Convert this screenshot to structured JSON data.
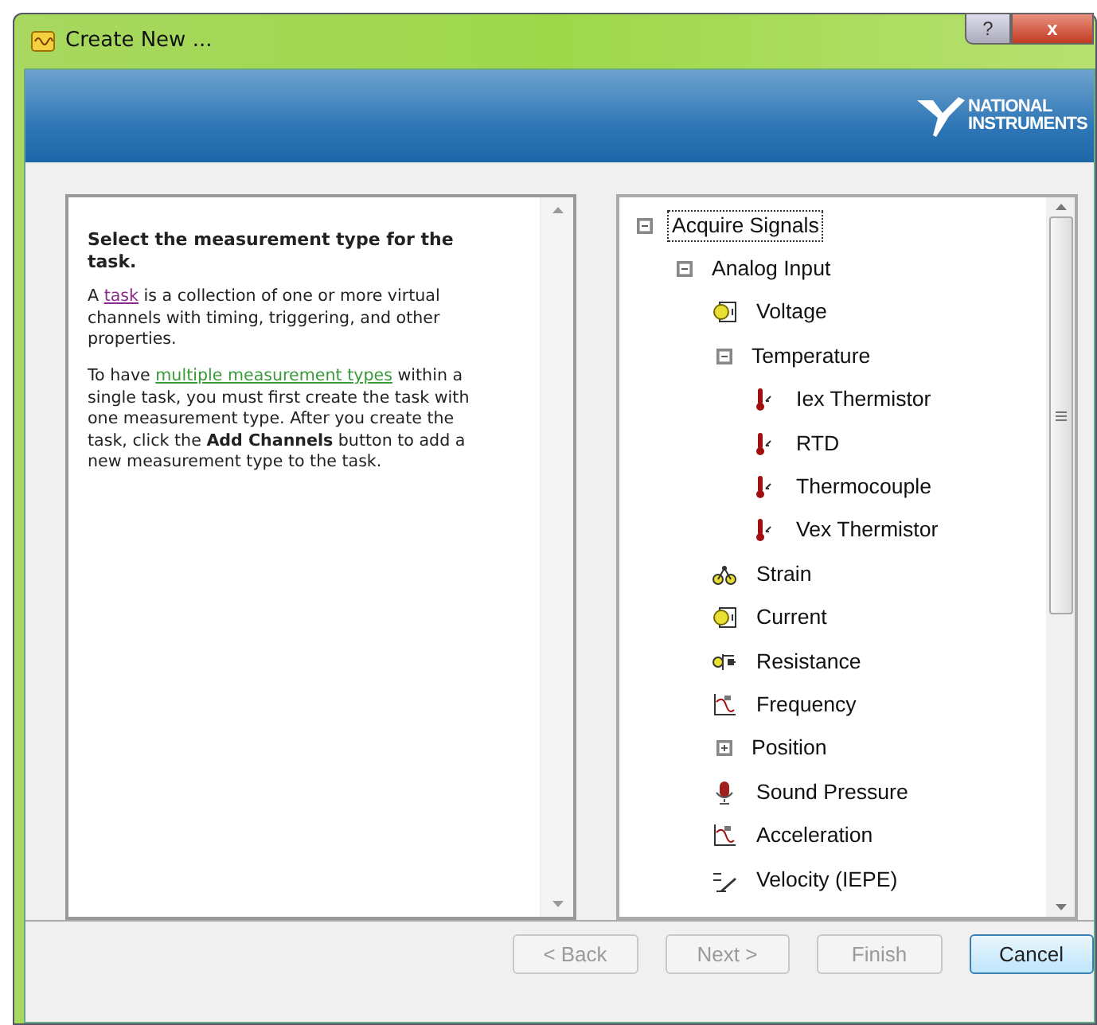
{
  "window": {
    "title": "Create New ..."
  },
  "title_buttons": [
    "?",
    "x"
  ],
  "banner": {
    "logo_top": "NATIONAL",
    "logo_bottom": "INSTRUMENTS"
  },
  "help": {
    "heading": "Select the measurement type for the task.",
    "paragraphs": [
      [
        {
          "kind": "text",
          "text": "A "
        },
        {
          "kind": "link",
          "text": "task",
          "visited": true
        },
        {
          "kind": "text",
          "text": " is a collection of one or more virtual channels with timing, triggering, and other properties."
        }
      ],
      [
        {
          "kind": "text",
          "text": "To have "
        },
        {
          "kind": "link",
          "text": "multiple measurement types",
          "visited": false
        },
        {
          "kind": "text",
          "text": " within a single task, you must first create the task with one measurement type. After you create the task, click the **Add Channels** button to add a new measurement type to the task."
        }
      ]
    ]
  },
  "tree": [
    {
      "label": "Acquire Signals",
      "selected": true,
      "expanded": true,
      "children": [
        {
          "label": "Analog Input",
          "selected": false,
          "expanded": true,
          "children": [
            {
              "label": "Voltage",
              "selected": false,
              "kind": "meter"
            },
            {
              "label": "Temperature",
              "selected": false,
              "expanded": true,
              "children": [
                {
                  "label": "Iex Thermistor",
                  "selected": false,
                  "kind": "thermometer"
                },
                {
                  "label": "RTD",
                  "selected": false,
                  "kind": "thermometer"
                },
                {
                  "label": "Thermocouple",
                  "selected": false,
                  "kind": "thermometer"
                },
                {
                  "label": "Vex Thermistor",
                  "selected": false,
                  "kind": "thermometer"
                }
              ]
            },
            {
              "label": "Strain",
              "selected": false,
              "kind": "strain"
            },
            {
              "label": "Current",
              "selected": false,
              "kind": "meter"
            },
            {
              "label": "Resistance",
              "selected": false,
              "kind": "resistor"
            },
            {
              "label": "Frequency",
              "selected": false,
              "kind": "graph"
            },
            {
              "label": "Position",
              "selected": false,
              "expanded": false
            },
            {
              "label": "Sound Pressure",
              "selected": false,
              "kind": "microphone"
            },
            {
              "label": "Acceleration",
              "selected": false,
              "kind": "graph"
            },
            {
              "label": "Velocity (IEPE)",
              "selected": false,
              "kind": "derivative"
            }
          ]
        }
      ]
    }
  ],
  "buttons": [
    {
      "label": "< Back",
      "disabled": true,
      "default": false
    },
    {
      "label": "Next >",
      "disabled": true,
      "default": false
    },
    {
      "label": "Finish",
      "disabled": true,
      "default": false
    },
    {
      "label": "Cancel",
      "disabled": false,
      "default": true
    }
  ]
}
